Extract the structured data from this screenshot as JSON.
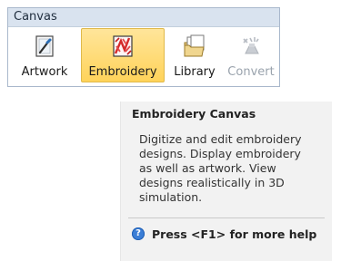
{
  "group": {
    "title": "Canvas",
    "buttons": [
      {
        "label": "Artwork",
        "icon": "artwork-icon",
        "state": "normal"
      },
      {
        "label": "Embroidery",
        "icon": "embroidery-icon",
        "state": "active"
      },
      {
        "label": "Library",
        "icon": "library-icon",
        "state": "normal"
      },
      {
        "label": "Convert",
        "icon": "convert-icon",
        "state": "disabled"
      }
    ]
  },
  "tooltip": {
    "title": "Embroidery Canvas",
    "body": "Digitize and edit embroidery designs. Display embroidery as well as artwork. View designs realistically in 3D simulation.",
    "help": "Press <F1> for more help",
    "help_icon": "help-icon"
  },
  "colors": {
    "active_bg": "#ffd35a",
    "header_bg": "#d9e3ef",
    "tooltip_bg": "#f2f2f2"
  }
}
